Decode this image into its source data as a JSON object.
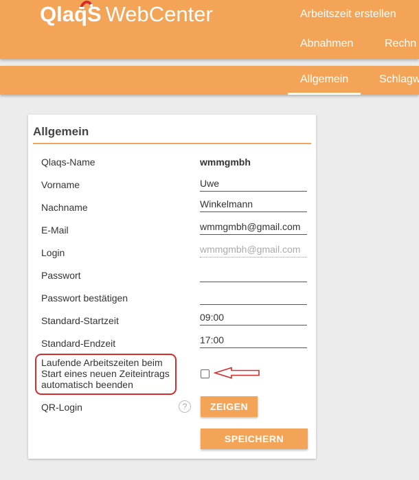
{
  "header": {
    "brand": "QlaqS",
    "product": "WebCenter",
    "nav": [
      "Arbeitszeit erstellen",
      "Abnahmen",
      "Rechn"
    ]
  },
  "subnav": {
    "tabs": [
      "Allgemein",
      "Schlagw"
    ],
    "active_tab": "Allgemein"
  },
  "card": {
    "title": "Allgemein",
    "fields": {
      "qlaqs_name": {
        "label": "Qlaqs-Name",
        "value": "wmmgmbh"
      },
      "vorname": {
        "label": "Vorname",
        "value": "Uwe"
      },
      "nachname": {
        "label": "Nachname",
        "value": "Winkelmann"
      },
      "email": {
        "label": "E-Mail",
        "value": "wmmgmbh@gmail.com"
      },
      "login": {
        "label": "Login",
        "placeholder": "wmmgmbh@gmail.com"
      },
      "passwort": {
        "label": "Passwort",
        "value": ""
      },
      "passwort_bestaetigen": {
        "label": "Passwort bestätigen",
        "value": ""
      },
      "startzeit": {
        "label": "Standard-Startzeit",
        "value": "09:00"
      },
      "endzeit": {
        "label": "Standard-Endzeit",
        "value": "17:00"
      },
      "auto_end": {
        "line1": "Laufende Arbeitszeiten beim",
        "line2": "Start eines neuen Zeiteintrags",
        "line3": "automatisch beenden",
        "checked": false
      },
      "qr_login": {
        "label": "QR-Login",
        "help": "?",
        "button": "ZEIGEN"
      }
    },
    "save_button": "SPEICHERN"
  },
  "colors": {
    "accent": "#f4a456",
    "annotation": "#d42b2b",
    "background": "#ececec"
  }
}
